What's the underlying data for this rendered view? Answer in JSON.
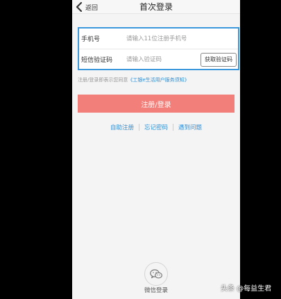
{
  "header": {
    "back_label": "返回",
    "title": "首次登录"
  },
  "form": {
    "phone_label": "手机号",
    "phone_placeholder": "请输入11位注册手机号",
    "code_label": "短信验证码",
    "code_placeholder": "请输入验证码",
    "get_code_label": "获取验证码"
  },
  "agreement": {
    "prefix": "注册/登录即表示您同意",
    "link": "《工银e生活用户服务须知》"
  },
  "submit_label": "注册/登录",
  "links": {
    "self_register": "自助注册",
    "forgot_password": "忘记密码",
    "problem": "遇到问题"
  },
  "wechat_label": "微信登录",
  "watermark": "头条 @每益生君",
  "colors": {
    "accent_blue": "#3b97db",
    "submit_red": "#f27f7a",
    "link_blue": "#2e8fd6"
  },
  "icons": {
    "back": "chevron-left-icon",
    "wechat": "wechat-icon"
  }
}
